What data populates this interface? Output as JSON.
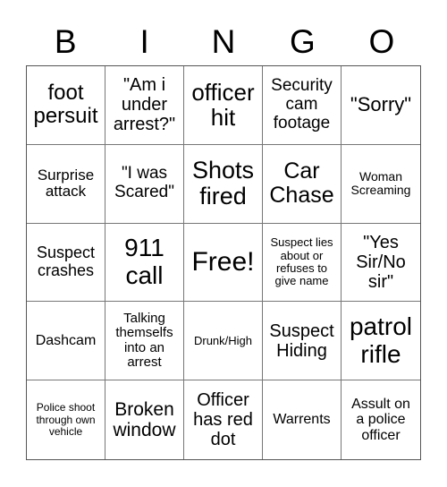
{
  "header": [
    "B",
    "I",
    "N",
    "G",
    "O"
  ],
  "cells": [
    {
      "text": "foot\npersuit",
      "size": 24
    },
    {
      "text": "\"Am i\nunder\narrest?\"",
      "size": 20
    },
    {
      "text": "officer\nhit",
      "size": 26
    },
    {
      "text": "Security\ncam\nfootage",
      "size": 19
    },
    {
      "text": "\"Sorry\"",
      "size": 22
    },
    {
      "text": "Surprise\nattack",
      "size": 17
    },
    {
      "text": "\"I was\nScared\"",
      "size": 19
    },
    {
      "text": "Shots\nfired",
      "size": 27
    },
    {
      "text": "Car\nChase",
      "size": 25
    },
    {
      "text": "Woman\nScreaming",
      "size": 14
    },
    {
      "text": "Suspect\ncrashes",
      "size": 18
    },
    {
      "text": "911\ncall",
      "size": 28
    },
    {
      "text": "Free!",
      "size": 30
    },
    {
      "text": "Suspect lies\nabout or\nrefuses to\ngive name",
      "size": 13
    },
    {
      "text": "\"Yes\nSir/No\nsir\"",
      "size": 20
    },
    {
      "text": "Dashcam",
      "size": 16
    },
    {
      "text": "Talking\nthemselfs\ninto an\narrest",
      "size": 15
    },
    {
      "text": "Drunk/High",
      "size": 13
    },
    {
      "text": "Suspect\nHiding",
      "size": 20
    },
    {
      "text": "patrol\nrifle",
      "size": 28
    },
    {
      "text": "Police shoot\nthrough own\nvehicle",
      "size": 12
    },
    {
      "text": "Broken\nwindow",
      "size": 21
    },
    {
      "text": "Officer\nhas red\ndot",
      "size": 20
    },
    {
      "text": "Warrents",
      "size": 16
    },
    {
      "text": "Assult on\na police\nofficer",
      "size": 16
    }
  ]
}
